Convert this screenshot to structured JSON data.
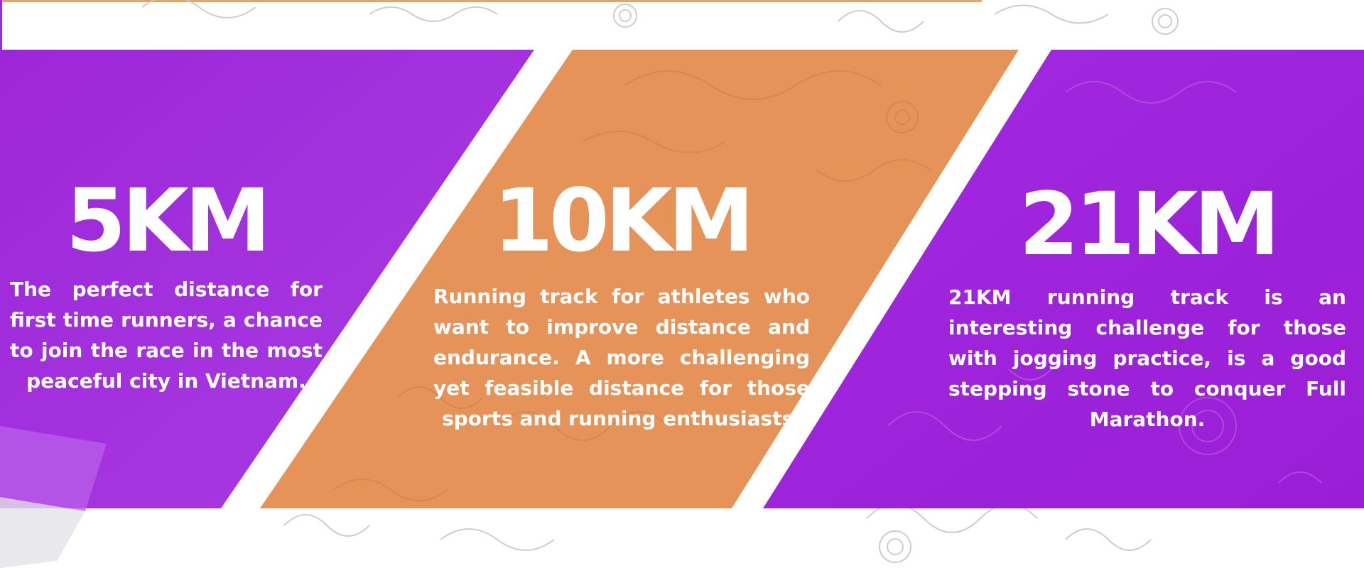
{
  "colors": {
    "purple": "#9d22d8",
    "purple_light": "#a63ae0",
    "orange": "#e59358",
    "pattern": "#b7b7b7"
  },
  "cards": [
    {
      "title": "5KM",
      "description": "The perfect distance for first time runners, a chance to join the race in the most peaceful city in Vietnam."
    },
    {
      "title": "10KM",
      "description": "Running track for athletes who want to improve distance and endurance. A more challenging yet feasible distance for those sports and running enthusiasts."
    },
    {
      "title": "21KM",
      "description": "21KM running track is an interesting challenge for those with jogging practice, is a good stepping stone to conquer Full Marathon."
    }
  ]
}
